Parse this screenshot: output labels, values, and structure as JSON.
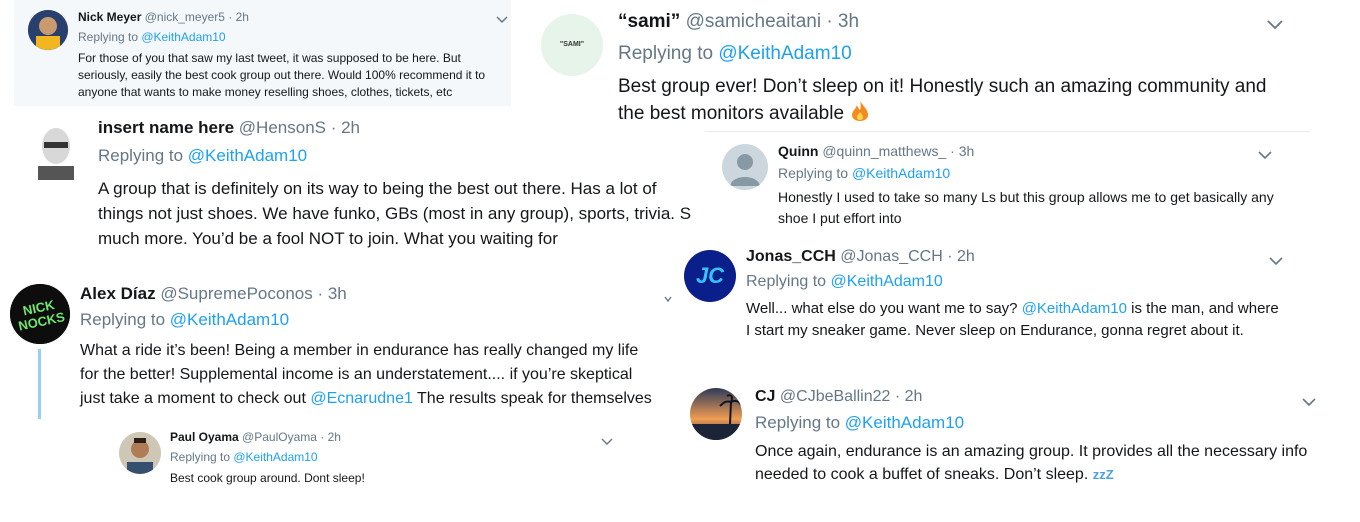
{
  "tweets": {
    "nick": {
      "name": "Nick Meyer",
      "handle": "@nick_meyer5 · 2h",
      "reply_prefix": "Replying to ",
      "reply_to": "@KeithAdam10",
      "text": "For those of you that saw my last tweet, it was supposed to be here. But seriously, easily the best cook group out there. Would 100% recommend it to anyone that wants to make money reselling shoes, clothes, tickets, etc"
    },
    "sami": {
      "name": "“sami”",
      "handle": "@samicheaitani · 3h",
      "reply_prefix": "Replying to ",
      "reply_to": "@KeithAdam10",
      "text": "Best group ever! Don’t sleep on it! Honestly such an amazing community and the best monitors available",
      "avatar_text": "\"SAMI\""
    },
    "insert": {
      "name": "insert name here",
      "handle": "@HensonS · 2h",
      "reply_prefix": "Replying to ",
      "reply_to": "@KeithAdam10",
      "line1": "A group that is definitely on its way to being the best out there. Has a lot of",
      "line2": "things not just shoes. We have funko, GBs (most in any group), sports, trivia. S",
      "line3": "much more. You’d be a fool NOT to join. What you waiting for"
    },
    "quinn": {
      "name": "Quinn",
      "handle": "@quinn_matthews_ · 3h",
      "reply_prefix": "Replying to ",
      "reply_to": "@KeithAdam10",
      "text": "Honestly I used to take so many Ls but this group allows me to get basically any shoe I put effort into"
    },
    "jonas": {
      "name": "Jonas_CCH",
      "handle": "@Jonas_CCH · 2h",
      "reply_prefix": "Replying to ",
      "reply_to": "@KeithAdam10",
      "text_pre": "Well... what else do you want me to say? ",
      "text_mention": "@KeithAdam10",
      "text_post": " is the man, and where",
      "line2": "I start my sneaker game. Never sleep on Endurance, gonna regret about it.",
      "avatar_text": "JC"
    },
    "alex": {
      "name": "Alex Díaz",
      "handle": "@SupremePoconos · 3h",
      "reply_prefix": "Replying to ",
      "reply_to": "@KeithAdam10",
      "line1": "What a ride it’s been! Being a member in endurance has really changed my life",
      "line2": "for the better! Supplemental income is an understatement.... if you’re skeptical",
      "line3_pre": "just take a moment to check out ",
      "line3_mention": "@Ecnarudne1",
      "line3_post": " The results speak for themselves",
      "avatar_text": "NICK NOCKS"
    },
    "cj": {
      "name": "CJ",
      "handle": "@CJbeBallin22 · 2h",
      "reply_prefix": "Replying to ",
      "reply_to": "@KeithAdam10",
      "line1": "Once again, endurance is an amazing group. It provides all the necessary info",
      "line2": "needed to cook a buffet of sneaks. Don’t sleep.",
      "emoji": "zzZ"
    },
    "paul": {
      "name": "Paul Oyama",
      "handle": "@PaulOyama · 2h",
      "reply_prefix": "Replying to ",
      "reply_to": "@KeithAdam10",
      "text": "Best cook group around. Dont sleep!"
    }
  },
  "colors": {
    "link": "#1da1f2",
    "muted": "#657786",
    "text": "#14171a",
    "nick_bg": "#f5f8fa",
    "sami_avatar": "#e6f4ea",
    "thread_line": "#9ad0f5"
  }
}
